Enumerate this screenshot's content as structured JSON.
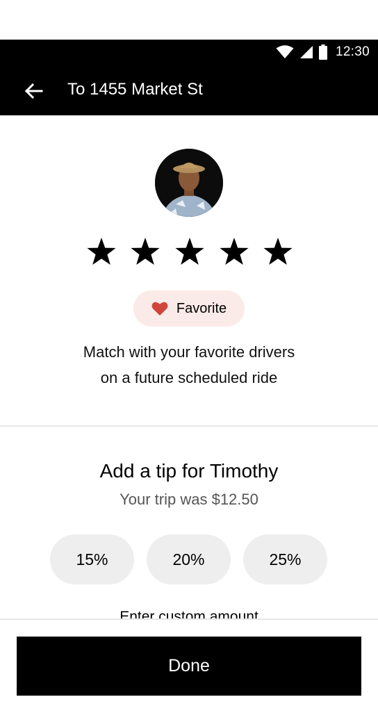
{
  "status_bar": {
    "time": "12:30",
    "icons": [
      "wifi-icon",
      "cell-signal-icon",
      "battery-icon"
    ]
  },
  "header": {
    "back_icon": "arrow-left-icon",
    "title": "To 1455 Market St"
  },
  "driver": {
    "avatar": "driver-avatar"
  },
  "rating": {
    "stars": 5,
    "selected": 5
  },
  "favorite": {
    "icon": "heart-icon",
    "label": "Favorite",
    "accent": "#d0453b",
    "background": "#fbebe8"
  },
  "match_text": {
    "line1": "Match with your favorite drivers",
    "line2": "on a future scheduled ride"
  },
  "tip": {
    "title": "Add a tip for Timothy",
    "trip_cost": "Your trip was $12.50",
    "options": [
      "15%",
      "20%",
      "25%"
    ],
    "custom_label": "Enter custom amount"
  },
  "footer": {
    "done_label": "Done"
  }
}
